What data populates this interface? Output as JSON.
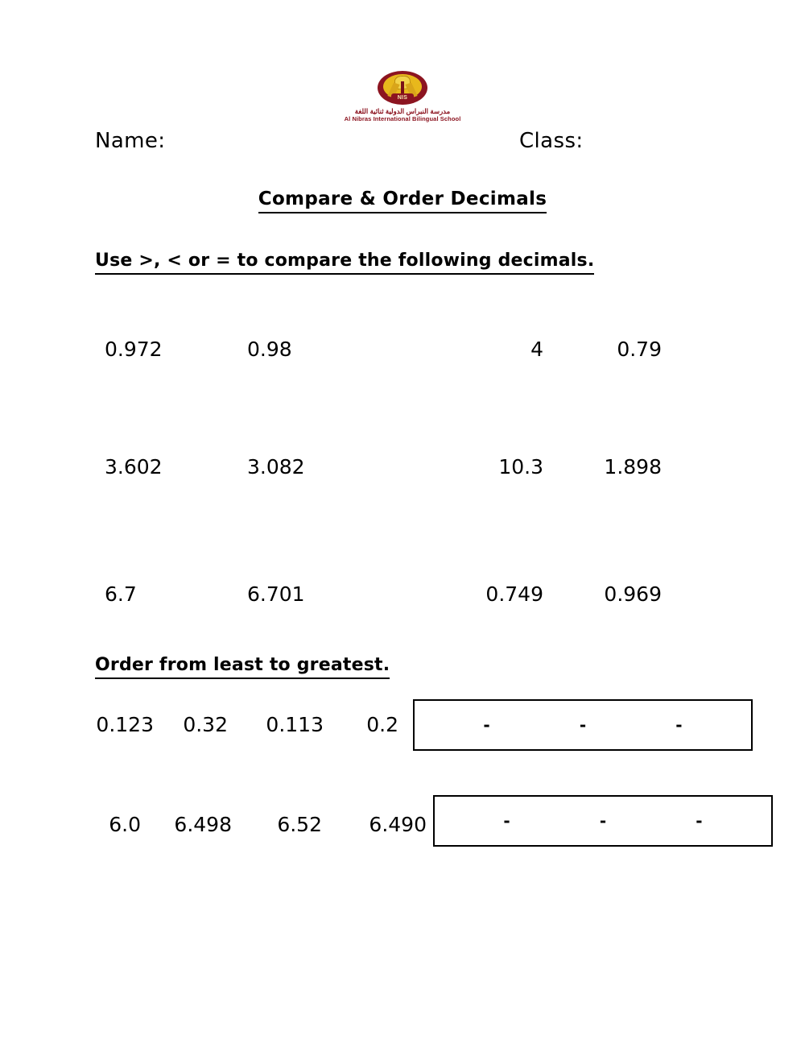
{
  "page": {
    "background": "#ffffff",
    "text_color": "#000000",
    "brand_color": "#8c1420"
  },
  "logo": {
    "mark_label": "NIS",
    "arabic_name": "مدرسة النبراس الدولية ثنائية اللغة",
    "english_name": "Al Nibras International Bilingual School"
  },
  "header": {
    "name_label": "Name:",
    "class_label": "Class:",
    "title": "Compare & Order Decimals"
  },
  "sections": {
    "compare": {
      "instruction": "Use >, < or = to compare the following decimals.",
      "rows": [
        {
          "left_a": "0.972",
          "left_b": "0.98",
          "right_a": "4",
          "right_b": "0.79"
        },
        {
          "left_a": "3.602",
          "left_b": "3.082",
          "right_a": "10.3",
          "right_b": "1.898"
        },
        {
          "left_a": "6.7",
          "left_b": "6.701",
          "right_a": "0.749",
          "right_b": "0.969"
        }
      ]
    },
    "order": {
      "instruction": "Order from least to greatest.",
      "rows": [
        {
          "numbers": [
            "0.123",
            "0.32",
            "0.113",
            "0.2"
          ],
          "answer_separators": [
            "-",
            "-",
            "-"
          ]
        },
        {
          "numbers": [
            "6.0",
            "6.498",
            "6.52",
            "6.490"
          ],
          "answer_separators": [
            "-",
            "-",
            "-"
          ]
        }
      ]
    }
  }
}
